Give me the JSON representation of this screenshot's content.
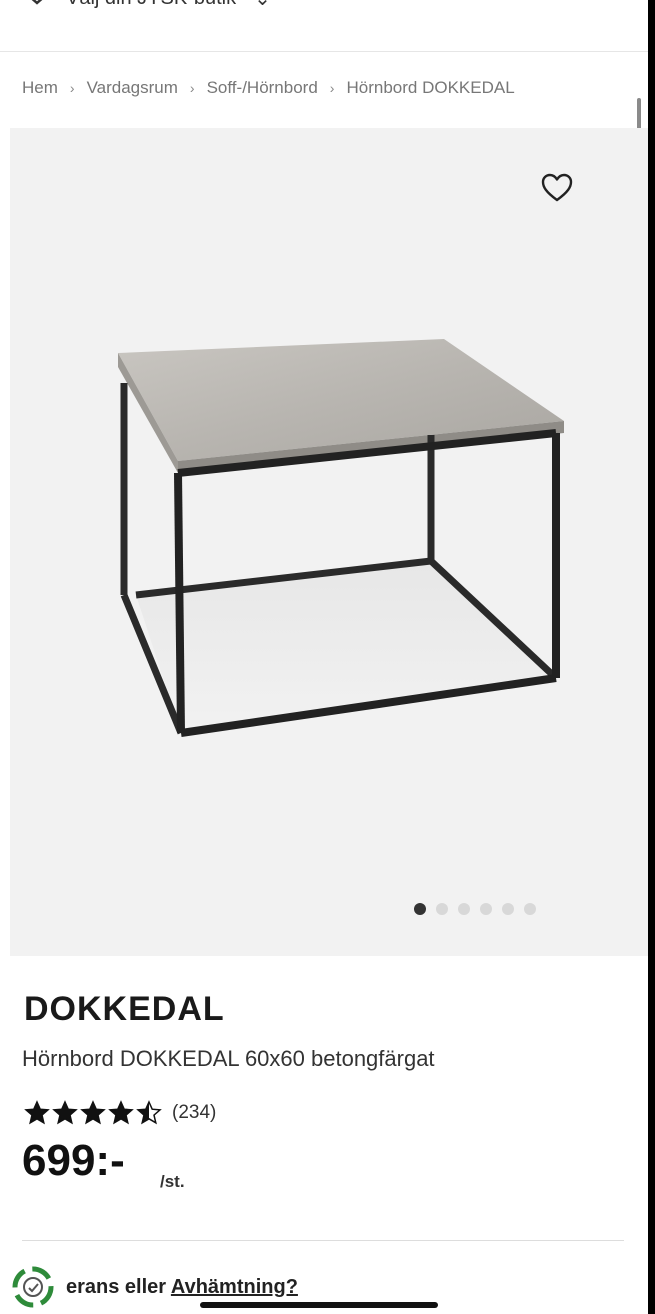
{
  "header": {
    "store_label": "Välj din JYSK-butik"
  },
  "breadcrumb": {
    "items": [
      "Hem",
      "Vardagsrum",
      "Soff-/Hörnbord",
      "Hörnbord DOKKEDAL"
    ],
    "separator": "›"
  },
  "gallery": {
    "image_count": 6,
    "active_index": 0,
    "favorite_icon": "heart-icon"
  },
  "product": {
    "brand": "DOKKEDAL",
    "title": "Hörnbord DOKKEDAL 60x60 betongfärgat",
    "rating": 4.5,
    "rating_max": 5,
    "review_count": "(234)",
    "price": "699:-",
    "unit": "/st."
  },
  "delivery": {
    "prefix": "erans eller ",
    "link": "Avhämtning?"
  },
  "colors": {
    "accent_green": "#2e8b3a",
    "gallery_bg": "#f2f2f2",
    "text_dark": "#111111"
  }
}
